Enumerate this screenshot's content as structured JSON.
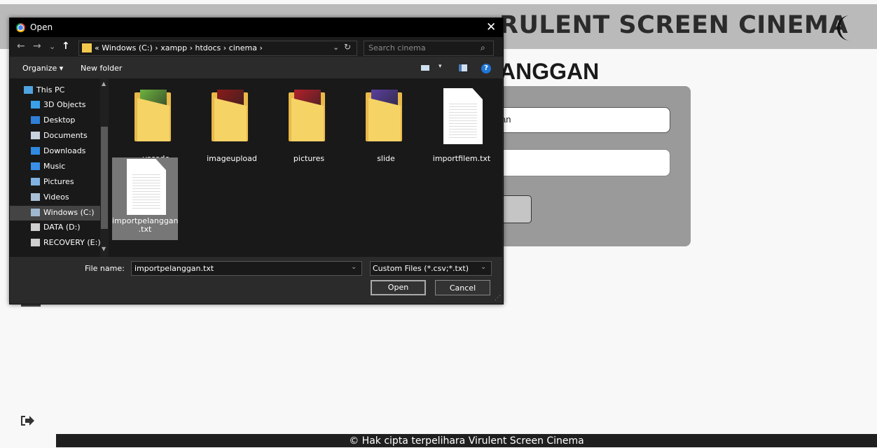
{
  "site": {
    "title": "RULENT SCREEN CINEMA",
    "page_heading": "ANGGAN",
    "name_field_value": "an",
    "footer": "© Hak cipta terpelihara Virulent Screen Cinema"
  },
  "dialog": {
    "title": "Open",
    "close_glyph": "✕",
    "nav": {
      "back": "←",
      "forward": "→",
      "recent": "⌄",
      "up": "↑"
    },
    "path": "« Windows (C:)  ›  xampp  ›  htdocs  ›  cinema  ›",
    "path_dropdown": "⌄",
    "refresh_glyph": "↻",
    "search_placeholder": "Search cinema",
    "search_glyph": "⌕",
    "toolbar": {
      "organize": "Organize ▾",
      "new_folder": "New folder",
      "view_dropdown": "▾",
      "help": "?"
    },
    "nav_items": [
      {
        "label": "This PC",
        "icon": "monitor-icon",
        "color": "#4fa3e0"
      },
      {
        "label": "3D Objects",
        "icon": "cube-icon",
        "color": "#3aa0e8"
      },
      {
        "label": "Desktop",
        "icon": "desktop-icon",
        "color": "#2f7fd6"
      },
      {
        "label": "Documents",
        "icon": "document-icon",
        "color": "#c8d3de"
      },
      {
        "label": "Downloads",
        "icon": "download-icon",
        "color": "#2f8ae0"
      },
      {
        "label": "Music",
        "icon": "music-icon",
        "color": "#3a8fe8"
      },
      {
        "label": "Pictures",
        "icon": "pictures-icon",
        "color": "#7fb2e0"
      },
      {
        "label": "Videos",
        "icon": "video-icon",
        "color": "#aac0d6"
      },
      {
        "label": "Windows (C:)",
        "icon": "drive-icon",
        "color": "#9fb8cf"
      },
      {
        "label": "DATA (D:)",
        "icon": "drive-icon",
        "color": "#cfcfcf"
      },
      {
        "label": "RECOVERY (E:)",
        "icon": "drive-icon",
        "color": "#cfcfcf"
      }
    ],
    "selected_nav": "Windows (C:)",
    "files": [
      {
        "name": ".vscode",
        "type": "folder",
        "art": "#6db33f"
      },
      {
        "name": "imageupload",
        "type": "folder",
        "art": "#8b1a1a"
      },
      {
        "name": "pictures",
        "type": "folder",
        "art": "#b3202a"
      },
      {
        "name": "slide",
        "type": "folder",
        "art": "#5a3fa0"
      },
      {
        "name": "importfilem.txt",
        "type": "text"
      },
      {
        "name": "importpelanggan .txt",
        "type": "text",
        "selected": true
      }
    ],
    "filename_label": "File name:",
    "filename_value": "importpelanggan.txt",
    "filetype": "Custom Files (*.csv;*.txt)",
    "dropdown_glyph": "⌄",
    "open_button": "Open",
    "cancel_button": "Cancel"
  }
}
